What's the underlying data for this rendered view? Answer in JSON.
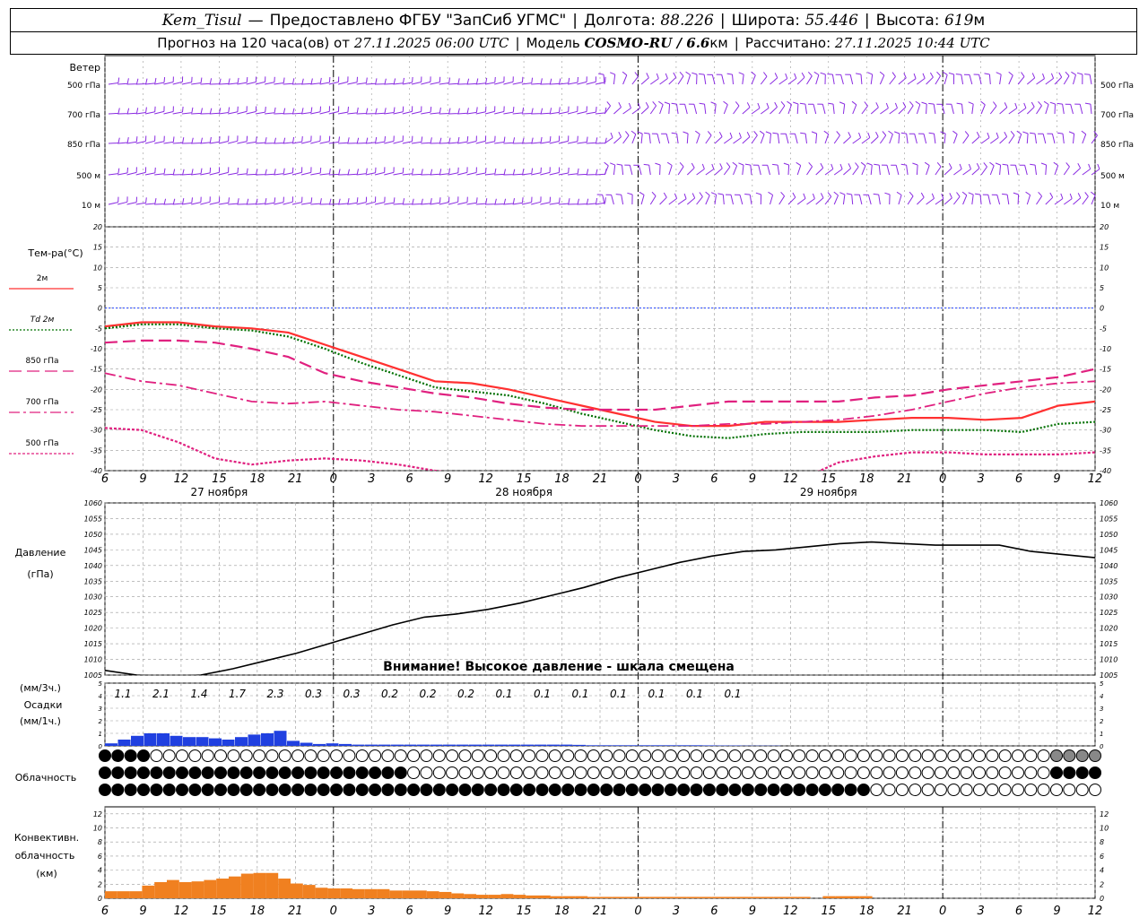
{
  "header": {
    "station": "Kem_Tisul",
    "provider": "Предоставлено ФГБУ \"ЗапСиб УГМС\"",
    "lon_label": "Долгота:",
    "lon": "88.226",
    "lat_label": "Широта:",
    "lat": "55.446",
    "alt_label": "Высота:",
    "alt": "619",
    "alt_unit": "м",
    "forecast_prefix": "Прогноз на 120 часа(ов) от",
    "forecast_from": "27.11.2025 06:00 UTC",
    "model_label": "Модель",
    "model": "COSMO-RU / 6.6",
    "model_unit": "км",
    "calc_label": "Рассчитано:",
    "calc": "27.11.2025 10:44 UTC"
  },
  "colors": {
    "wind": "#8a2be2",
    "t2m": "#ff3030",
    "td2m": "#007000",
    "t850": "#e0207f",
    "t700": "#e0207f",
    "t500": "#e0207f",
    "zero_line": "#2040ff",
    "precip": "#2040e0",
    "convective": "#f08020",
    "grid": "#999999"
  },
  "wind_panel": {
    "title": "Ветер",
    "levels": [
      "500 гПа",
      "700 гПа",
      "850 гПа",
      "500 м",
      "10 м"
    ]
  },
  "time_axis": {
    "ticks": [
      "6",
      "9",
      "12",
      "15",
      "18",
      "21",
      "0",
      "3",
      "6",
      "9",
      "12",
      "15",
      "18",
      "21",
      "0",
      "3",
      "6",
      "9",
      "12",
      "15",
      "18",
      "21",
      "0",
      "3",
      "6",
      "9",
      "12"
    ],
    "dates": [
      "27 ноября",
      "28 ноября",
      "29 ноября"
    ]
  },
  "temp_panel": {
    "title": "Тем-ра(°C)",
    "legend": [
      {
        "label": "2м",
        "style": "solid"
      },
      {
        "label": "Td  2м",
        "style": "dotted"
      },
      {
        "label": "850 гПа",
        "style": "dashed"
      },
      {
        "label": "700 гПа",
        "style": "dashdot"
      },
      {
        "label": "500 гПа",
        "style": "dotted-thin"
      }
    ],
    "yticks": [
      "20",
      "15",
      "10",
      "5",
      "0",
      "-5",
      "-10",
      "-15",
      "-20",
      "-25",
      "-30",
      "-35",
      "-40"
    ]
  },
  "pressure_panel": {
    "title1": "Давление",
    "title2": "(гПа)",
    "warning": "Внимание! Высокое давление - шкала смещена",
    "yticks": [
      "1060",
      "1055",
      "1050",
      "1045",
      "1040",
      "1035",
      "1030",
      "1025",
      "1020",
      "1015",
      "1010",
      "1005"
    ]
  },
  "precip_panel": {
    "unit3h": "(мм/3ч.)",
    "title": "Осадки",
    "unit1h": "(мм/1ч.)",
    "yticks": [
      "5",
      "4",
      "3",
      "2",
      "1",
      "0"
    ],
    "sums": [
      "1.1",
      "2.1",
      "1.4",
      "1.7",
      "2.3",
      "0.3",
      "0.3",
      "0.2",
      "0.2",
      "0.2",
      "0.1",
      "0.1",
      "0.1",
      "0.1",
      "0.1",
      "0.1",
      "0.1"
    ]
  },
  "cloud_panel": {
    "title": "Облачность"
  },
  "conv_panel": {
    "title1": "Конвективн.",
    "title2": "облачность",
    "title3": "(км)",
    "yticks": [
      "12",
      "10",
      "8",
      "6",
      "4",
      "2",
      "0"
    ]
  },
  "chart_data": [
    {
      "type": "line",
      "title": "Тем-ра(°C)",
      "x_hours": [
        0,
        6,
        12,
        18,
        24,
        30,
        36,
        42,
        48,
        54,
        60,
        66,
        72,
        78,
        84,
        90,
        96,
        102,
        108,
        114,
        120,
        126,
        132,
        138,
        144,
        150,
        156
      ],
      "ylim": [
        -40,
        20
      ],
      "series": [
        {
          "name": "2м",
          "values": [
            -4.5,
            -3.5,
            -3.5,
            -4.5,
            -5,
            -6,
            -9,
            -12,
            -15,
            -18,
            -18.5,
            -20,
            -22,
            -24,
            -26,
            -28,
            -29,
            -29,
            -28,
            -28,
            -28,
            -27.5,
            -27,
            -27,
            -27.5,
            -27,
            -24,
            -23
          ]
        },
        {
          "name": "Td  2м",
          "values": [
            -5,
            -4,
            -4,
            -5,
            -5.5,
            -7,
            -10,
            -13.5,
            -16.5,
            -19.5,
            -20.5,
            -21.5,
            -23.5,
            -26,
            -28,
            -30,
            -31.5,
            -32,
            -31,
            -30.5,
            -30.5,
            -30.5,
            -30,
            -30,
            -30,
            -30.5,
            -28.5,
            -28
          ]
        },
        {
          "name": "850 гПа",
          "values": [
            -8.5,
            -8,
            -8,
            -8.5,
            -10,
            -12,
            -16,
            -18,
            -19.5,
            -21,
            -22,
            -23.5,
            -24.5,
            -25,
            -25,
            -25,
            -24,
            -23,
            -23,
            -23,
            -23,
            -22,
            -21.5,
            -20,
            -19,
            -18,
            -17,
            -15
          ]
        },
        {
          "name": "700 гПа",
          "values": [
            -16,
            -18,
            -19,
            -21,
            -23,
            -23.5,
            -23,
            -24,
            -25,
            -25.5,
            -26.5,
            -27.5,
            -28.5,
            -29,
            -29,
            -29,
            -29,
            -28.5,
            -28.5,
            -28,
            -27.5,
            -26.5,
            -25,
            -23,
            -21,
            -19.5,
            -18.5,
            -18
          ]
        },
        {
          "name": "500 гПа",
          "values": [
            -29.5,
            -30,
            -33,
            -37,
            -38.5,
            -37.5,
            -37,
            -37.5,
            -38.5,
            -40,
            -41,
            -42,
            -43,
            -44,
            -44,
            -44.5,
            -44.5,
            -44,
            -43,
            -42,
            -38,
            -36.5,
            -35.5,
            -35.5,
            -36,
            -36,
            -36,
            -35.5
          ]
        }
      ]
    },
    {
      "type": "line",
      "title": "Давление (гПа)",
      "x_hours": [
        0,
        6,
        12,
        18,
        24,
        30,
        36,
        42,
        48,
        54,
        60,
        66,
        72,
        78,
        84,
        90,
        96,
        102,
        108,
        114,
        120,
        126,
        132,
        138,
        144,
        150,
        156
      ],
      "ylim": [
        1005,
        1060
      ],
      "series": [
        {
          "name": "pressure",
          "values": [
            1006.5,
            1005,
            1004.5,
            1005,
            1007,
            1009.5,
            1012,
            1015,
            1018,
            1021,
            1023.5,
            1024.5,
            1026,
            1028,
            1030.5,
            1033,
            1036,
            1038.5,
            1041,
            1043,
            1044.5,
            1045,
            1046,
            1047,
            1047.5,
            1047,
            1046.5,
            1046.5,
            1046.5,
            1044.5,
            1043.5,
            1042.5
          ]
        }
      ]
    },
    {
      "type": "bar",
      "title": "Осадки (мм/1ч.)",
      "ylim": [
        0,
        5
      ],
      "values": [
        0.2,
        0.5,
        0.8,
        1.0,
        1.0,
        0.8,
        0.7,
        0.7,
        0.6,
        0.5,
        0.7,
        0.9,
        1.0,
        1.2,
        0.4,
        0.25,
        0.15,
        0.2,
        0.15,
        0.1,
        0.1,
        0.1,
        0.1,
        0.1,
        0.1,
        0.1,
        0.1,
        0.1,
        0.1,
        0.1,
        0.1,
        0.1,
        0.1,
        0.1,
        0.1,
        0.1,
        0.08,
        0.05,
        0.05,
        0.05,
        0.05,
        0.05,
        0.05,
        0.05,
        0.05,
        0.05,
        0.04,
        0.03,
        0.03,
        0.02,
        0.02,
        0.02
      ]
    },
    {
      "type": "bar",
      "title": "Конвективн. облачность (км)",
      "ylim": [
        0,
        13
      ],
      "values": [
        1.0,
        1.0,
        1.0,
        1.8,
        2.3,
        2.6,
        2.3,
        2.4,
        2.6,
        2.8,
        3.1,
        3.5,
        3.6,
        3.6,
        2.8,
        2.1,
        1.9,
        1.5,
        1.4,
        1.4,
        1.3,
        1.3,
        1.3,
        1.1,
        1.1,
        1.1,
        1.0,
        0.9,
        0.7,
        0.6,
        0.5,
        0.5,
        0.6,
        0.5,
        0.4,
        0.4,
        0.3,
        0.3,
        0.3,
        0.2,
        0.2,
        0.2,
        0.2,
        0.2,
        0.2,
        0.2,
        0.2,
        0.2,
        0.2,
        0.2,
        0.2,
        0.2,
        0.2,
        0.2,
        0.2,
        0.2,
        0.2,
        0,
        0.3,
        0.3,
        0.3,
        0.3
      ]
    }
  ]
}
